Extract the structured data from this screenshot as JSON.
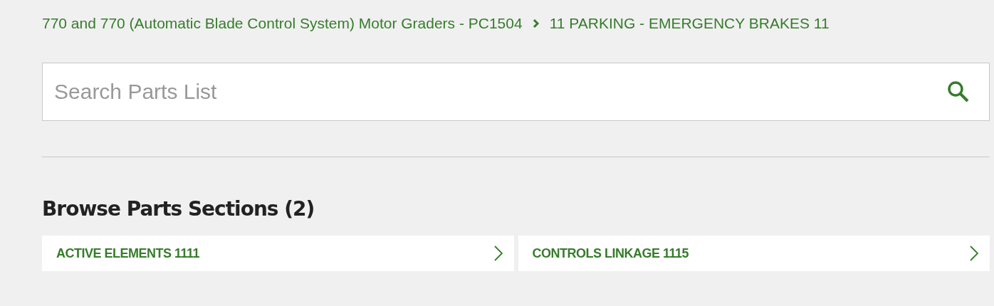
{
  "breadcrumb": [
    {
      "label": "770 and 770 (Automatic Blade Control System) Motor Graders - PC1504"
    },
    {
      "label": "11 PARKING - EMERGENCY BRAKES 11"
    }
  ],
  "search": {
    "placeholder": "Search Parts List"
  },
  "sections": {
    "title": "Browse Parts Sections (2)",
    "items": [
      {
        "label": "ACTIVE ELEMENTS 1111"
      },
      {
        "label": "CONTROLS LINKAGE 1115"
      }
    ]
  }
}
